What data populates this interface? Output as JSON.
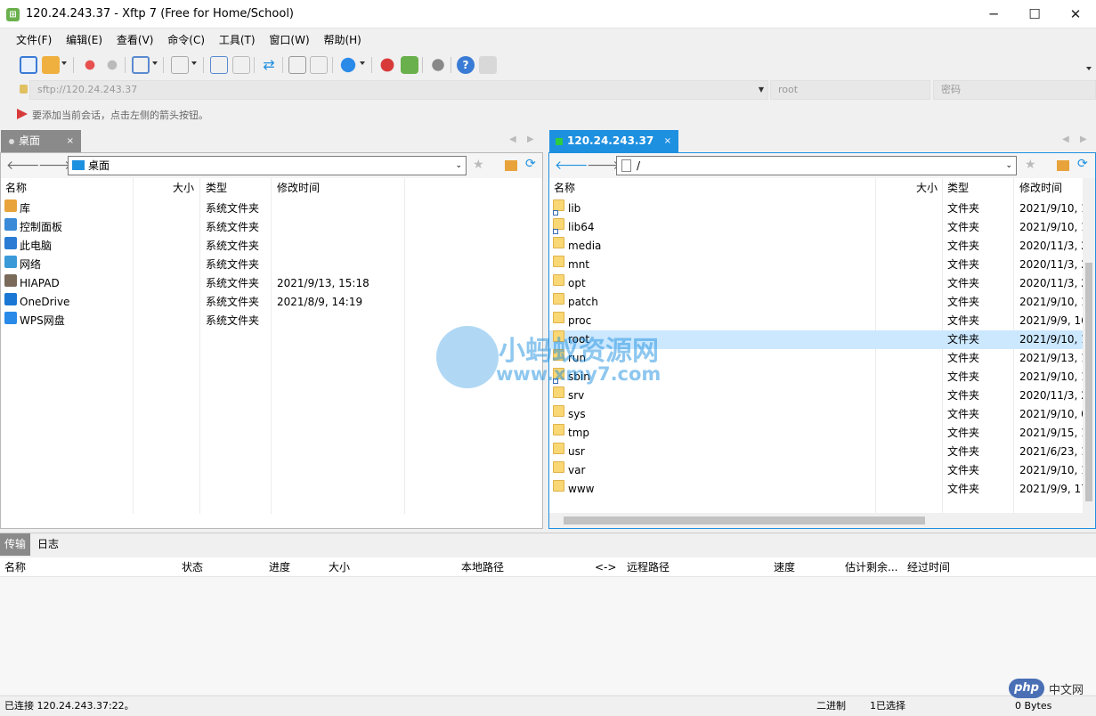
{
  "window": {
    "title": "120.24.243.37 - Xftp 7 (Free for Home/School)",
    "minimize": "─",
    "maximize": "☐",
    "close": "✕"
  },
  "menu": [
    "文件(F)",
    "编辑(E)",
    "查看(V)",
    "命令(C)",
    "工具(T)",
    "窗口(W)",
    "帮助(H)"
  ],
  "address": {
    "url": "sftp://120.24.243.37",
    "user": "root",
    "password_placeholder": "密码"
  },
  "hint": "要添加当前会话，点击左侧的箭头按钮。",
  "left": {
    "tab": "桌面",
    "path": "桌面",
    "columns": {
      "name": "名称",
      "size": "大小",
      "type": "类型",
      "modified": "修改时间"
    },
    "rows": [
      {
        "name": "库",
        "type": "系统文件夹",
        "modified": "",
        "icon": "library-icon",
        "color": "#e8a33a"
      },
      {
        "name": "控制面板",
        "type": "系统文件夹",
        "modified": "",
        "icon": "control-panel-icon",
        "color": "#3a8ad8"
      },
      {
        "name": "此电脑",
        "type": "系统文件夹",
        "modified": "",
        "icon": "computer-icon",
        "color": "#2a7bd4"
      },
      {
        "name": "网络",
        "type": "系统文件夹",
        "modified": "",
        "icon": "network-icon",
        "color": "#3a9ad8"
      },
      {
        "name": "HIAPAD",
        "type": "系统文件夹",
        "modified": "2021/9/13, 15:18",
        "icon": "user-icon",
        "color": "#7a6a5a"
      },
      {
        "name": "OneDrive",
        "type": "系统文件夹",
        "modified": "2021/8/9, 14:19",
        "icon": "cloud-icon",
        "color": "#1a78d4"
      },
      {
        "name": "WPS网盘",
        "type": "系统文件夹",
        "modified": "",
        "icon": "cloud-icon",
        "color": "#2a8ae8"
      }
    ]
  },
  "right": {
    "tab": "120.24.243.37",
    "path": "/",
    "columns": {
      "name": "名称",
      "size": "大小",
      "type": "类型",
      "modified": "修改时间"
    },
    "selected": "root",
    "rows": [
      {
        "name": "lib",
        "type": "文件夹",
        "modified": "2021/9/10, 1",
        "link": true
      },
      {
        "name": "lib64",
        "type": "文件夹",
        "modified": "2021/9/10, 1",
        "link": true
      },
      {
        "name": "media",
        "type": "文件夹",
        "modified": "2020/11/3, 2",
        "link": false
      },
      {
        "name": "mnt",
        "type": "文件夹",
        "modified": "2020/11/3, 2",
        "link": false
      },
      {
        "name": "opt",
        "type": "文件夹",
        "modified": "2020/11/3, 2",
        "link": false
      },
      {
        "name": "patch",
        "type": "文件夹",
        "modified": "2021/9/10, 1",
        "link": false
      },
      {
        "name": "proc",
        "type": "文件夹",
        "modified": "2021/9/9, 16",
        "link": false
      },
      {
        "name": "root",
        "type": "文件夹",
        "modified": "2021/9/10, 1",
        "link": false
      },
      {
        "name": "run",
        "type": "文件夹",
        "modified": "2021/9/13, 1",
        "link": false
      },
      {
        "name": "sbin",
        "type": "文件夹",
        "modified": "2021/9/10, 1",
        "link": true
      },
      {
        "name": "srv",
        "type": "文件夹",
        "modified": "2020/11/3, 2",
        "link": false
      },
      {
        "name": "sys",
        "type": "文件夹",
        "modified": "2021/9/10, 0",
        "link": false
      },
      {
        "name": "tmp",
        "type": "文件夹",
        "modified": "2021/9/15, 1",
        "link": false
      },
      {
        "name": "usr",
        "type": "文件夹",
        "modified": "2021/6/23, 1",
        "link": false
      },
      {
        "name": "var",
        "type": "文件夹",
        "modified": "2021/9/10, 1",
        "link": false
      },
      {
        "name": "www",
        "type": "文件夹",
        "modified": "2021/9/9, 17",
        "link": false
      }
    ]
  },
  "transfer": {
    "tabs": [
      "传输",
      "日志"
    ],
    "columns": [
      "名称",
      "状态",
      "进度",
      "大小",
      "本地路径",
      "<->",
      "远程路径",
      "速度",
      "估计剩余...",
      "经过时间"
    ]
  },
  "watermark": {
    "title": "小蚂蚁资源网",
    "url": "www.xmy7.com"
  },
  "php_badge": {
    "logo": "php",
    "label": "中文网"
  },
  "status": {
    "connection": "已连接 120.24.243.37:22。",
    "mode": "二进制",
    "selection": "1已选择",
    "bytes": "0 Bytes"
  },
  "colors": {
    "accent": "#1e90e0",
    "selection": "#cce8ff",
    "folder": "#f9d775"
  }
}
